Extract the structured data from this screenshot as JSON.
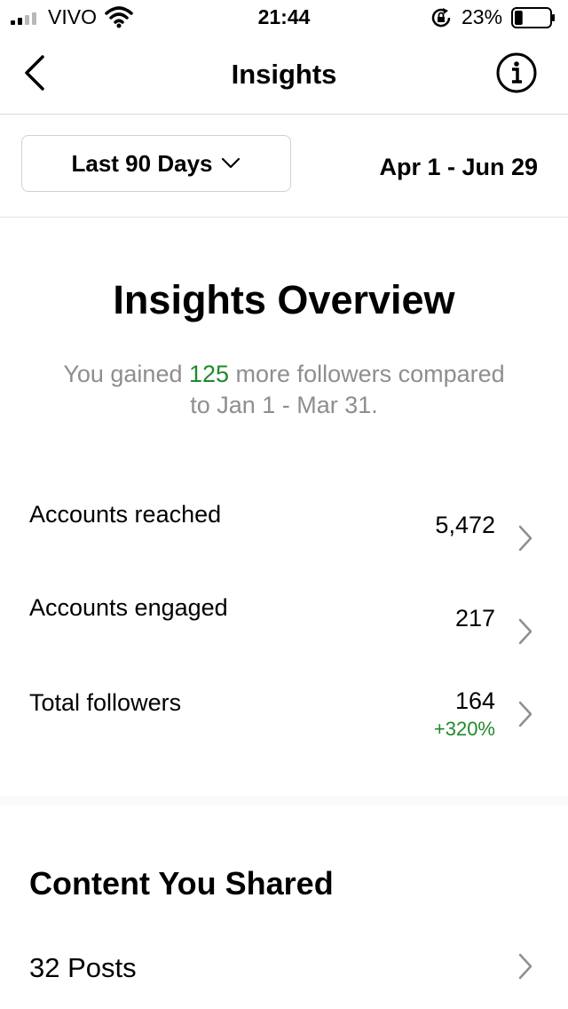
{
  "status_bar": {
    "carrier": "VIVO",
    "time": "21:44",
    "battery_percent": "23%",
    "battery_level": 0.23,
    "icons": [
      "signal-icon",
      "wifi-icon",
      "rotation-lock-icon",
      "battery-icon"
    ]
  },
  "nav": {
    "title": "Insights",
    "back_icon": "back-chevron-icon",
    "info_icon": "info-icon"
  },
  "range": {
    "selected": "Last 90 Days",
    "dates": "Apr 1 - Jun 29"
  },
  "overview": {
    "title": "Insights Overview",
    "summary_prefix": "You gained ",
    "summary_highlight": "125",
    "summary_suffix": " more followers compared to Jan 1 - Mar 31."
  },
  "metrics": [
    {
      "label": "Accounts reached",
      "value": "5,472"
    },
    {
      "label": "Accounts engaged",
      "value": "217"
    },
    {
      "label": "Total followers",
      "value": "164",
      "change": "+320%"
    }
  ],
  "content": {
    "title": "Content You Shared",
    "posts_label": "32 Posts"
  },
  "colors": {
    "positive": "#1e8a2c",
    "muted_text": "#8e8e8e",
    "divider": "#dbdbdb"
  }
}
